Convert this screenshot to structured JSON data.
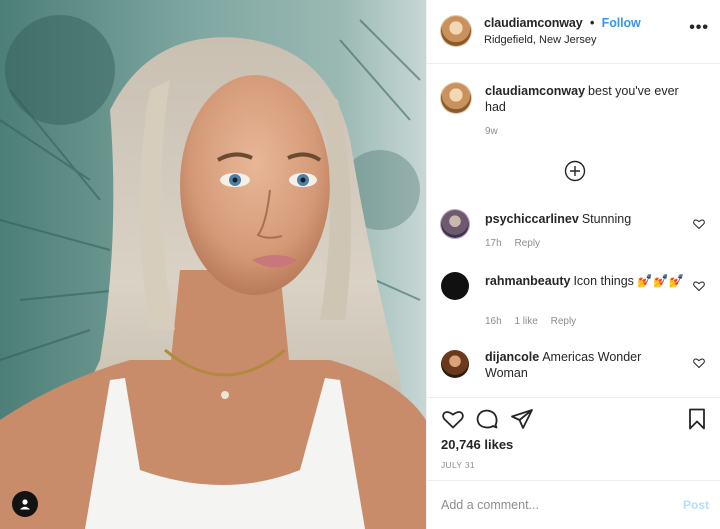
{
  "post": {
    "photo_alt": "Portrait photo",
    "user_icon": "user-icon"
  },
  "header": {
    "username": "claudiamconway",
    "separator": "•",
    "follow_label": "Follow",
    "location": "Ridgefield, New Jersey",
    "more_icon": "more-options-icon",
    "more_glyph": "•••"
  },
  "caption": {
    "username": "claudiamconway",
    "text": "best you've ever had",
    "time": "9w"
  },
  "load_more_icon": "plus-circle-icon",
  "comments": [
    {
      "username": "psychiccarlinev",
      "text": "Stunning",
      "time": "17h",
      "likes": "",
      "reply": "Reply"
    },
    {
      "username": "rahmanbeauty",
      "text": "Icon things 💅💅💅",
      "time": "16h",
      "likes": "1 like",
      "reply": "Reply"
    },
    {
      "username": "dijancole",
      "text": "Americas Wonder Woman",
      "time": "",
      "likes": "",
      "reply": ""
    }
  ],
  "actions": {
    "like_icon": "heart-icon",
    "comment_icon": "comment-icon",
    "share_icon": "share-icon",
    "save_icon": "bookmark-icon"
  },
  "likes": "20,746 likes",
  "date": "JULY 31",
  "add_comment": {
    "placeholder": "Add a comment...",
    "post_label": "Post"
  },
  "colors": {
    "accent": "#3897f0",
    "post_disabled": "#b2dffc",
    "muted": "#8e8e8e",
    "text": "#262626"
  }
}
